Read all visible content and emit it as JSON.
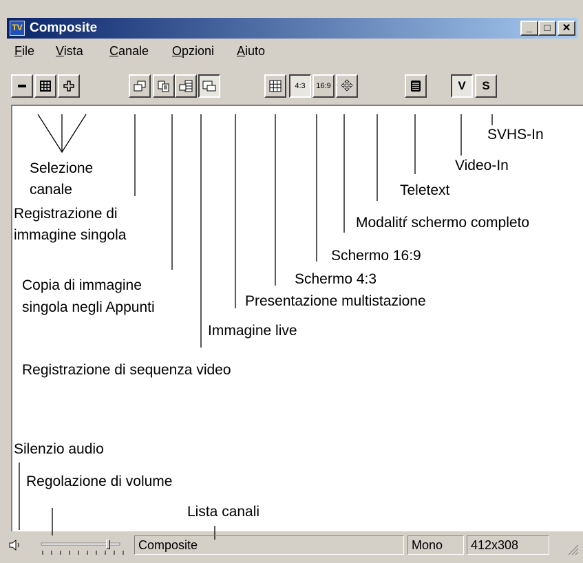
{
  "window": {
    "title": "Composite",
    "app_icon_glyph": "TV",
    "controls": {
      "minimize": "_",
      "maximize": "□",
      "close": "✕"
    }
  },
  "menu": [
    "File",
    "Vista",
    "Canale",
    "Opzioni",
    "Aiuto"
  ],
  "toolbar": {
    "buttons": [
      {
        "name": "channel-down-button",
        "icon": "minus-icon"
      },
      {
        "name": "channel-list-button",
        "icon": "grid-icon"
      },
      {
        "name": "channel-up-button",
        "icon": "plus-icon"
      },
      {
        "name": "snapshot-button",
        "icon": "snapshot-icon"
      },
      {
        "name": "copy-clipboard-button",
        "icon": "copy-icon"
      },
      {
        "name": "video-record-button",
        "icon": "video-record-icon"
      },
      {
        "name": "live-image-button",
        "icon": "live-icon",
        "pressed": true
      },
      {
        "name": "multistation-button",
        "icon": "multigrid-icon"
      },
      {
        "name": "screen-4-3-button",
        "label": "4:3",
        "pressed": true
      },
      {
        "name": "screen-16-9-button",
        "label": "16:9"
      },
      {
        "name": "fullscreen-button",
        "icon": "move-arrows-icon"
      },
      {
        "name": "teletext-button",
        "icon": "teletext-icon"
      },
      {
        "name": "video-in-button",
        "label": "V",
        "pressed": true
      },
      {
        "name": "svhs-in-button",
        "label": "S"
      }
    ]
  },
  "annotations": {
    "channel_select": [
      "Selezione",
      "canale"
    ],
    "single_image_rec": [
      "Registrazione di",
      "immagine singola"
    ],
    "copy_clipboard": [
      "Copia di immagine",
      "singola negli Appunti"
    ],
    "live_image": "Immagine live",
    "video_sequence": "Registrazione di sequenza video",
    "multistation": "Presentazione multistazione",
    "screen_4_3": "Schermo 4:3",
    "screen_16_9": "Schermo 16:9",
    "fullscreen": "Modalitŕ schermo completo",
    "teletext": "Teletext",
    "video_in": "Video-In",
    "svhs_in": "SVHS-In",
    "mute": "Silenzio audio",
    "volume": "Regolazione di volume",
    "channel_list": "Lista canali"
  },
  "statusbar": {
    "channel": "Composite",
    "audio_mode": "Mono",
    "resolution": "412x308",
    "volume_level": 0.85
  }
}
